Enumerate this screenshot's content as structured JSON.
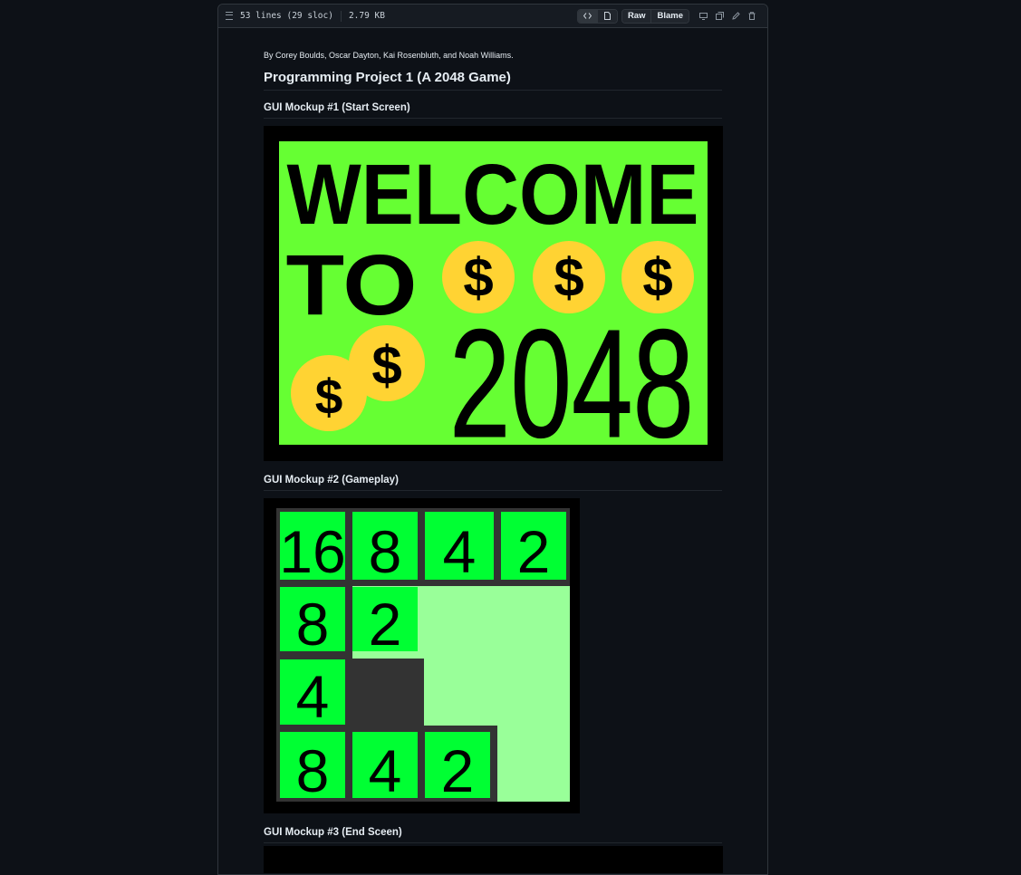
{
  "header": {
    "lines_info": "53 lines (29 sloc)",
    "size": "2.79 KB",
    "raw_label": "Raw",
    "blame_label": "Blame"
  },
  "readme": {
    "byline": "By Corey Boulds, Oscar Dayton, Kai Rosenbluth, and Noah Williams.",
    "title": "Programming Project 1 (A 2048 Game)",
    "mockup1_heading": "GUI Mockup #1 (Start Screen)",
    "mockup1_image": {
      "word1": "WELCOME",
      "word2": "TO",
      "word3": "2048",
      "coin_symbol": "$"
    },
    "mockup2_heading": "GUI Mockup #2 (Gameplay)",
    "mockup2_board": [
      [
        "16",
        "8",
        "4",
        "2"
      ],
      [
        "8",
        "2",
        "",
        ""
      ],
      [
        "4",
        "",
        "",
        ""
      ],
      [
        "8",
        "4",
        "2",
        ""
      ]
    ],
    "mockup3_heading": "GUI Mockup #3 (End Sceen)"
  },
  "colors": {
    "start_bg": "#66ff33",
    "coin": "#ffd333",
    "tile": "#00ff33",
    "empty": "#99ff99",
    "grid": "#333333"
  }
}
